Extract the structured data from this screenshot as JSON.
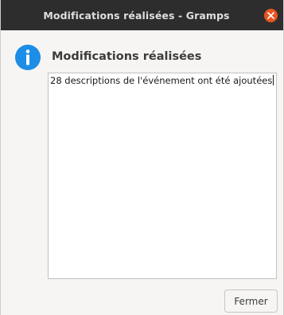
{
  "window": {
    "title": "Modifications réalisées - Gramps"
  },
  "dialog": {
    "heading": "Modifications réalisées",
    "message": "28 descriptions de l'événement ont été ajoutées",
    "close_label": "Fermer"
  },
  "icons": {
    "info": "info-icon",
    "close": "close-icon"
  },
  "colors": {
    "titlebar_bg": "#2d2d2d",
    "close_button": "#e95420",
    "info_icon": "#1a8be0"
  }
}
